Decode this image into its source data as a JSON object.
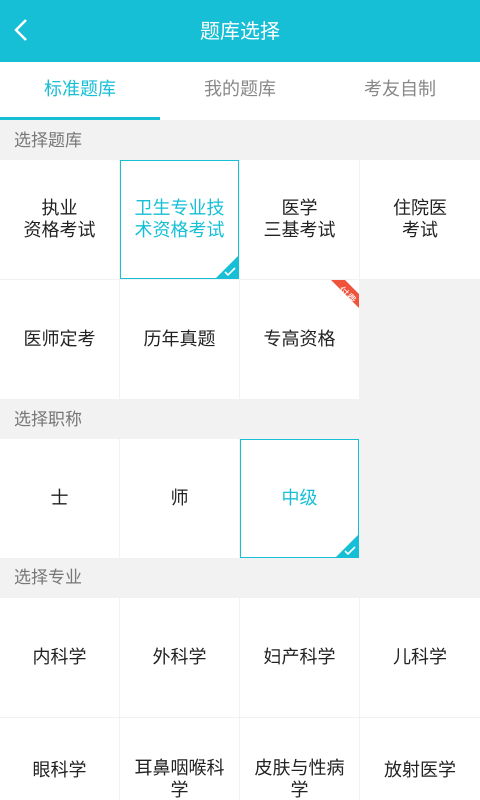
{
  "header": {
    "title": "题库选择",
    "accent_color": "#16bfd6",
    "back_icon": "chevron-left-icon"
  },
  "tabs": [
    {
      "label": "标准题库",
      "active": true
    },
    {
      "label": "我的题库",
      "active": false
    },
    {
      "label": "考友自制",
      "active": false
    }
  ],
  "sections": {
    "library": {
      "label": "选择题库",
      "items": [
        {
          "label": "执业\n资格考试",
          "selected": false
        },
        {
          "label": "卫生专业技\n术资格考试",
          "selected": true
        },
        {
          "label": "医学\n三基考试",
          "selected": false
        },
        {
          "label": "住院医\n考试",
          "selected": false
        },
        {
          "label": "医师定考",
          "selected": false
        },
        {
          "label": "历年真题",
          "selected": false
        },
        {
          "label": "专高资格",
          "selected": false,
          "badge": "付费",
          "badge_color": "#f0533c"
        }
      ]
    },
    "title_level": {
      "label": "选择职称",
      "items": [
        {
          "label": "士",
          "selected": false
        },
        {
          "label": "师",
          "selected": false
        },
        {
          "label": "中级",
          "selected": true
        }
      ]
    },
    "specialty": {
      "label": "选择专业",
      "items": [
        {
          "label": "内科学",
          "selected": false
        },
        {
          "label": "外科学",
          "selected": false
        },
        {
          "label": "妇产科学",
          "selected": false
        },
        {
          "label": "儿科学",
          "selected": false
        },
        {
          "label": "眼科学",
          "selected": false
        },
        {
          "label": "耳鼻咽喉科学",
          "selected": false
        },
        {
          "label": "皮肤与性病学",
          "selected": false
        },
        {
          "label": "放射医学",
          "selected": false
        }
      ]
    }
  }
}
